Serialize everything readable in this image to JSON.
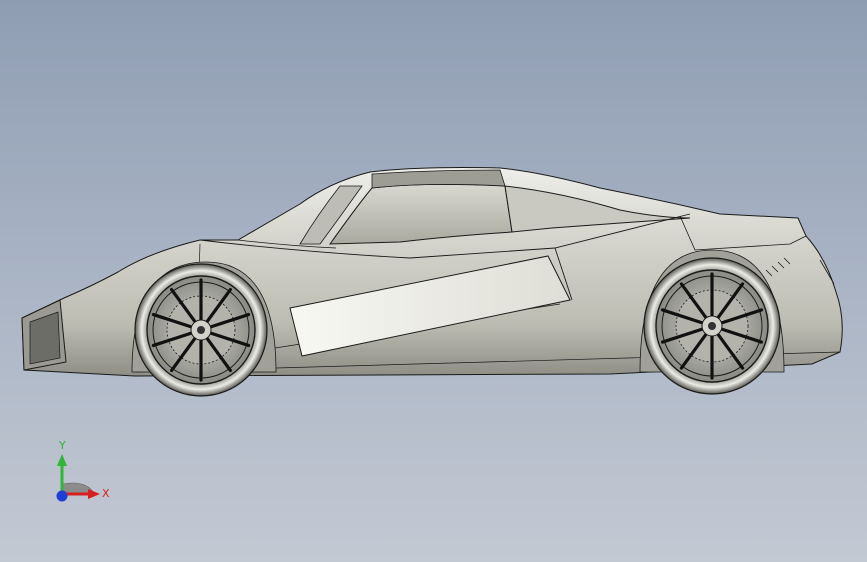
{
  "triad": {
    "y_label": "Y",
    "x_label": "X",
    "colors": {
      "y_axis": "#2fb537",
      "x_axis": "#d81f1f",
      "z_axis": "#1d3fd6",
      "triad_plane": "#8c8c8c"
    }
  },
  "viewport": {
    "background_top": "#8f9db3",
    "background_bottom": "#c3c9d3",
    "model_body_color": "#cfd0c8",
    "model_edge_color": "#1a1a1a"
  },
  "icons": {
    "model": "car-3d-model",
    "triad": "axis-triad-icon"
  }
}
